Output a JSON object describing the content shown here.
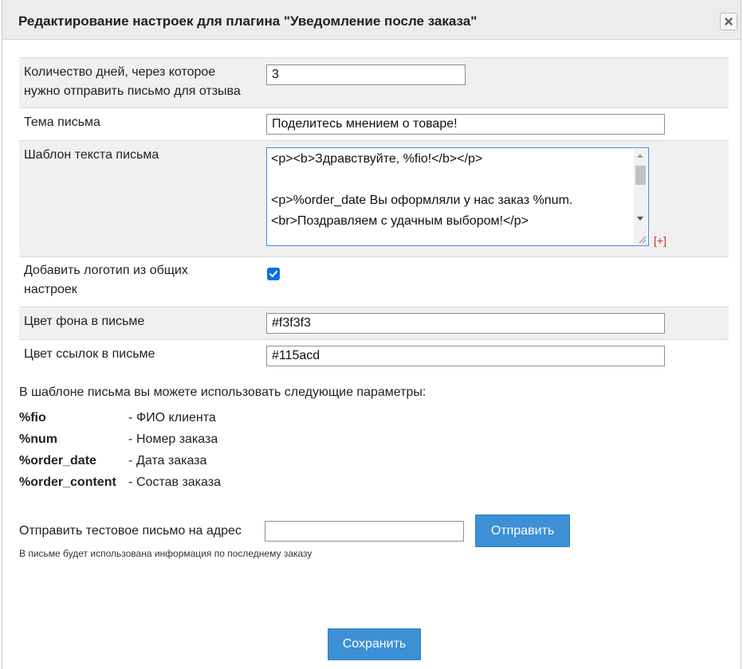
{
  "dialog": {
    "title": "Редактирование настроек для плагина \"Уведомление после заказа\"",
    "close_icon": "close-icon"
  },
  "settings": {
    "days": {
      "label_line1": "Количество дней, через которое",
      "label_line2": "нужно отправить письмо для отзыва",
      "value": "3"
    },
    "subject": {
      "label": "Тема письма",
      "value": "Поделитесь мнением о товаре!"
    },
    "template": {
      "label": "Шаблон текста письма",
      "lines": [
        "<p><b>Здравствуйте, %fio!</b></p>",
        "",
        "<p>%order_date Вы оформляли у нас заказ %num.",
        "<br>Поздравляем с удачным выбором!</p>"
      ],
      "expand_label": "[+]"
    },
    "logo": {
      "label_line1": "Добавить логотип из общих",
      "label_line2": "настроек",
      "checked": true
    },
    "bg_color": {
      "label": "Цвет фона в письме",
      "value": "#f3f3f3"
    },
    "link_color": {
      "label": "Цвет ссылок в письме",
      "value": "#115acd"
    }
  },
  "params": {
    "intro": "В шаблоне письма вы можете использовать следующие параметры:",
    "items": [
      {
        "name": "%fio",
        "dash": "-",
        "desc": "ФИО клиента"
      },
      {
        "name": "%num",
        "dash": "-",
        "desc": "Номер заказа"
      },
      {
        "name": "%order_date",
        "dash": "-",
        "desc": "Дата заказа"
      },
      {
        "name": "%order_content",
        "dash": "-",
        "desc": "Состав заказа"
      }
    ]
  },
  "test": {
    "label": "Отправить тестовое письмо на адрес",
    "value": "",
    "send_label": "Отправить",
    "note": "В письме будет использована информация по последнему заказу"
  },
  "footer": {
    "save_label": "Сохранить"
  },
  "colors": {
    "button": "#3d8fd6",
    "checkbox": "#0a72e0",
    "expand_link": "#c0392b",
    "row_shade": "#f0f0f0"
  }
}
